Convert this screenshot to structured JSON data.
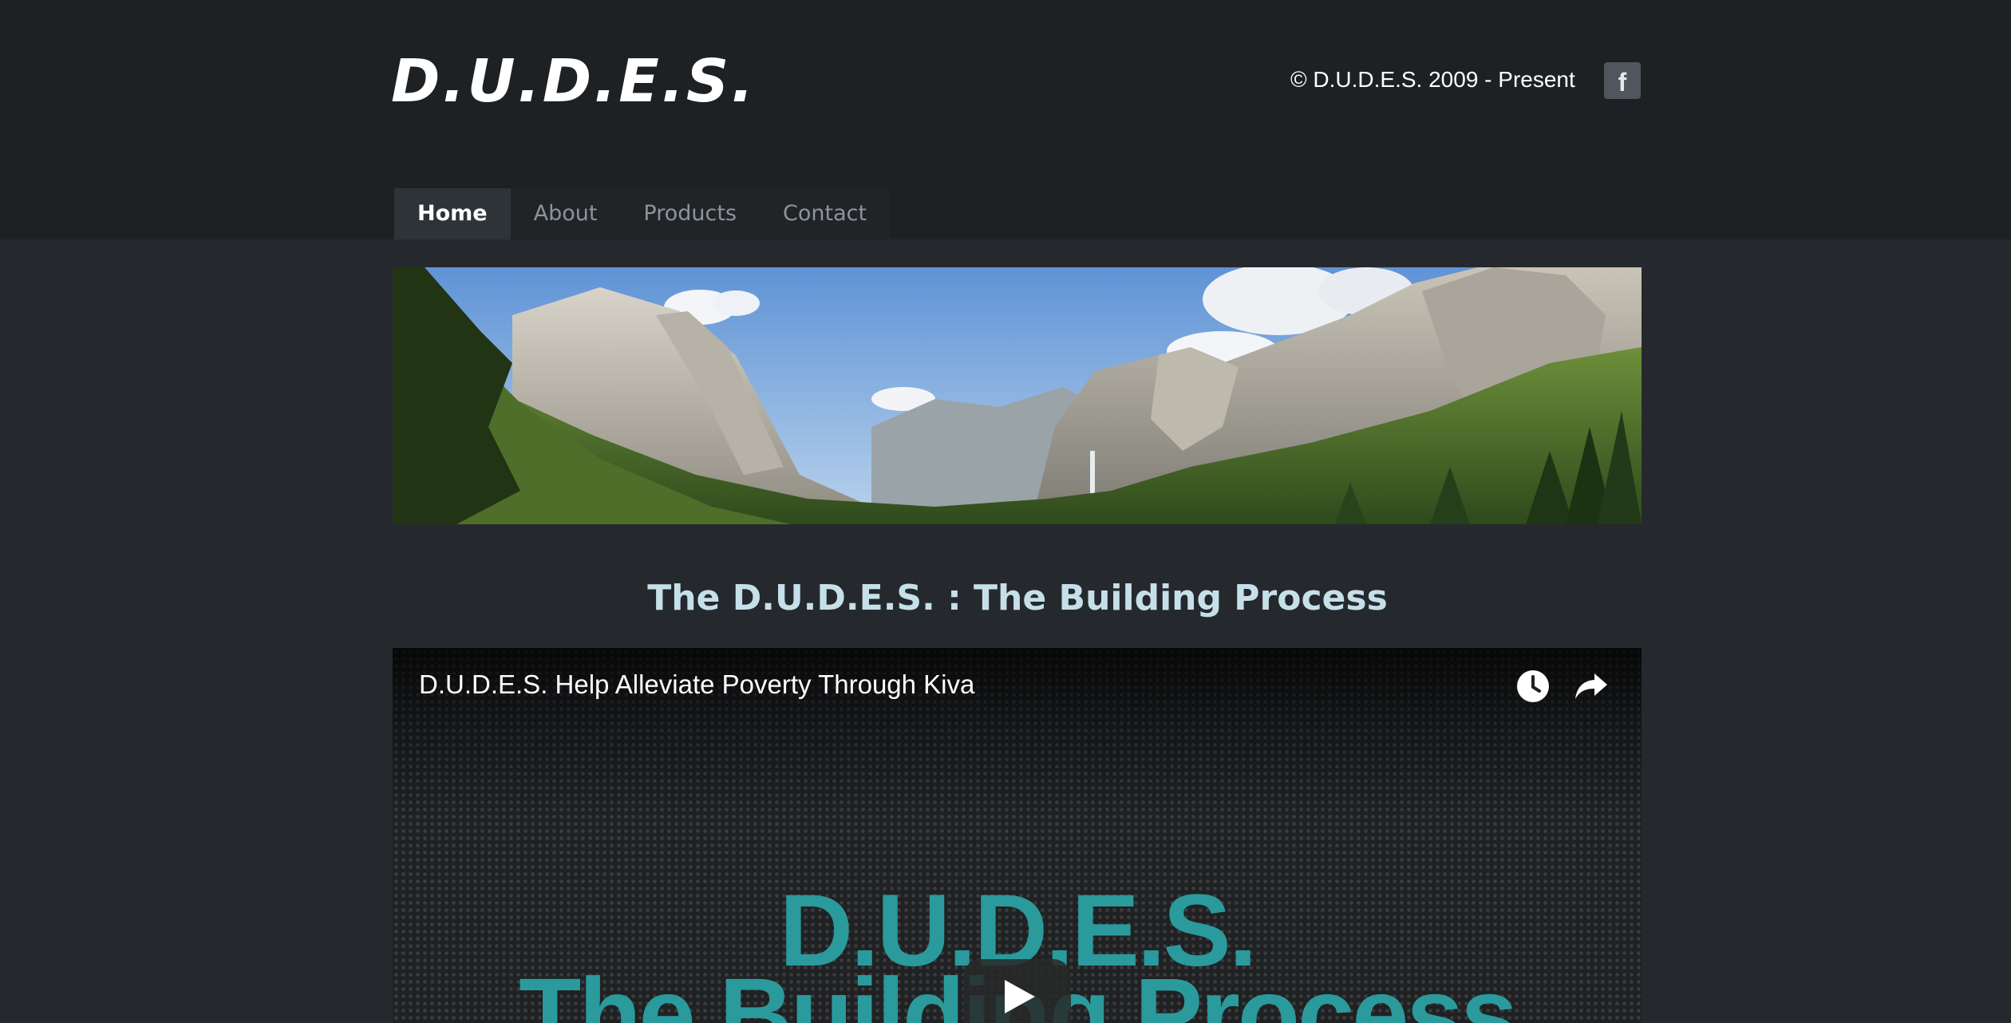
{
  "header": {
    "logo": "D.U.D.E.S.",
    "copyright": "© D.U.D.E.S. 2009 - Present",
    "facebook_icon": "facebook-icon"
  },
  "nav": {
    "items": [
      {
        "label": "Home",
        "active": true
      },
      {
        "label": "About",
        "active": false
      },
      {
        "label": "Products",
        "active": false
      },
      {
        "label": "Contact",
        "active": false
      }
    ]
  },
  "banner": {
    "image": "mountain-valley-panorama"
  },
  "main": {
    "title": "The D.U.D.E.S. : The Building Process"
  },
  "video": {
    "title": "D.U.D.E.S. Help Alleviate Poverty Through Kiva",
    "thumbnail_line1": "D.U.D.E.S.",
    "thumbnail_line2": "The Building Process",
    "watch_later_icon": "clock-icon",
    "share_icon": "share-icon",
    "play_icon": "play-icon"
  },
  "colors": {
    "header_bg": "#1e2124",
    "page_bg": "#25292d",
    "title_color": "#c6e0ea",
    "thumbnail_text": "#2a9a9c"
  }
}
